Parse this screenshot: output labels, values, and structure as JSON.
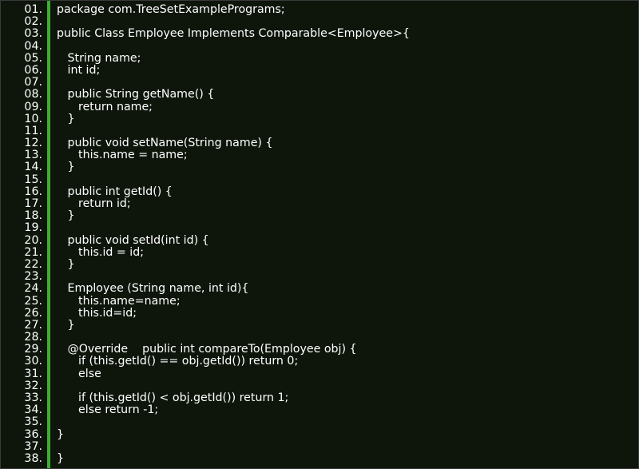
{
  "editor": {
    "lines": [
      {
        "num": "01.",
        "text": "package com.TreeSetExamplePrograms;"
      },
      {
        "num": "02.",
        "text": ""
      },
      {
        "num": "03.",
        "text": "public Class Employee Implements Comparable<Employee>{"
      },
      {
        "num": "04.",
        "text": ""
      },
      {
        "num": "05.",
        "text": "   String name;"
      },
      {
        "num": "06.",
        "text": "   int id;"
      },
      {
        "num": "07.",
        "text": ""
      },
      {
        "num": "08.",
        "text": "   public String getName() {"
      },
      {
        "num": "09.",
        "text": "      return name;"
      },
      {
        "num": "10.",
        "text": "   }"
      },
      {
        "num": "11.",
        "text": ""
      },
      {
        "num": "12.",
        "text": "   public void setName(String name) {"
      },
      {
        "num": "13.",
        "text": "      this.name = name;"
      },
      {
        "num": "14.",
        "text": "   }"
      },
      {
        "num": "15.",
        "text": ""
      },
      {
        "num": "16.",
        "text": "   public int getId() {"
      },
      {
        "num": "17.",
        "text": "      return id;"
      },
      {
        "num": "18.",
        "text": "   }"
      },
      {
        "num": "19.",
        "text": ""
      },
      {
        "num": "20.",
        "text": "   public void setId(int id) {"
      },
      {
        "num": "21.",
        "text": "      this.id = id;"
      },
      {
        "num": "22.",
        "text": "   }"
      },
      {
        "num": "23.",
        "text": ""
      },
      {
        "num": "24.",
        "text": "   Employee (String name, int id){"
      },
      {
        "num": "25.",
        "text": "      this.name=name;"
      },
      {
        "num": "26.",
        "text": "      this.id=id;"
      },
      {
        "num": "27.",
        "text": "   }"
      },
      {
        "num": "28.",
        "text": ""
      },
      {
        "num": "29.",
        "text": "   @Override    public int compareTo(Employee obj) {"
      },
      {
        "num": "30.",
        "text": "      if (this.getId() == obj.getId()) return 0;"
      },
      {
        "num": "31.",
        "text": "      else"
      },
      {
        "num": "32.",
        "text": ""
      },
      {
        "num": "33.",
        "text": "      if (this.getId() < obj.getId()) return 1;"
      },
      {
        "num": "34.",
        "text": "      else return -1;"
      },
      {
        "num": "35.",
        "text": ""
      },
      {
        "num": "36.",
        "text": "}"
      },
      {
        "num": "37.",
        "text": ""
      },
      {
        "num": "38.",
        "text": "}"
      }
    ]
  },
  "colors": {
    "background": "#0e160c",
    "gutter_rule": "#3fae33",
    "text": "#ffffff"
  }
}
